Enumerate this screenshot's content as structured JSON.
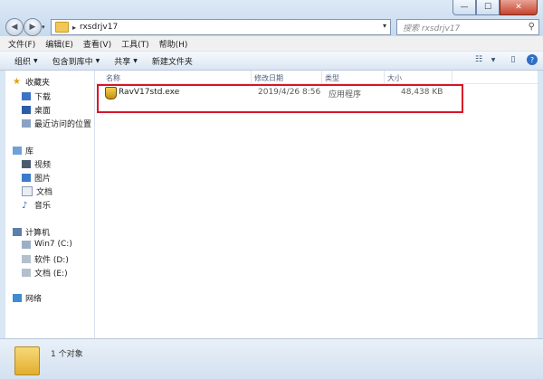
{
  "window": {
    "caption_buttons": {
      "min": "—",
      "max": "☐",
      "close": "✕"
    }
  },
  "address": {
    "path": "rxsdrjv17"
  },
  "search": {
    "placeholder": "搜索 rxsdrjv17"
  },
  "menu": [
    "文件(F)",
    "编辑(E)",
    "查看(V)",
    "工具(T)",
    "帮助(H)"
  ],
  "toolbar": {
    "organize": "组织",
    "include": "包含到库中",
    "share": "共享",
    "new_folder": "新建文件夹"
  },
  "nav": {
    "favorites": {
      "label": "收藏夹",
      "items": [
        "下载",
        "桌面",
        "最近访问的位置"
      ]
    },
    "libraries": {
      "label": "库",
      "items": [
        "视频",
        "图片",
        "文档",
        "音乐"
      ]
    },
    "computer": {
      "label": "计算机",
      "items": [
        "Win7 (C:)",
        "软件 (D:)",
        "文档 (E:)"
      ]
    },
    "network": {
      "label": "网络"
    }
  },
  "columns": {
    "name": "名称",
    "date": "修改日期",
    "type": "类型",
    "size": "大小"
  },
  "files": [
    {
      "name": "RavV17std.exe",
      "date": "2019/4/26 8:56",
      "type": "应用程序",
      "size": "48,438 KB"
    }
  ],
  "status": {
    "count": "1 个对象"
  },
  "colors": {
    "highlight_box": "#d8142a",
    "chrome": "#d9e6f3"
  }
}
